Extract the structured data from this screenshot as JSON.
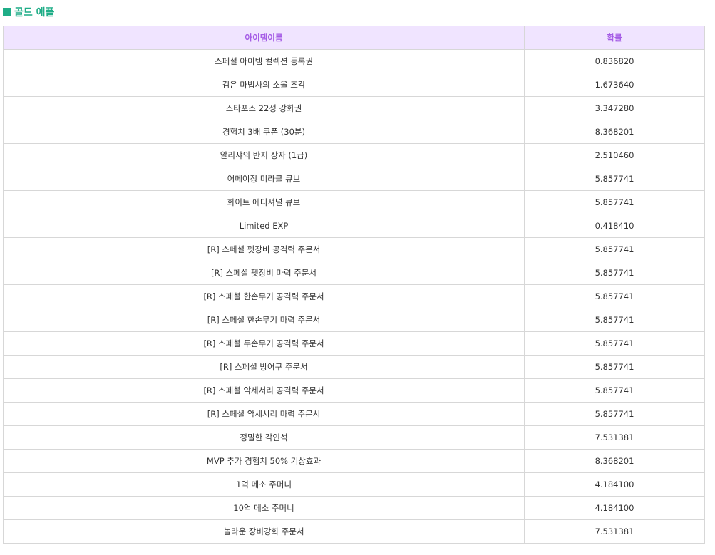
{
  "section": {
    "title": "골드 애플",
    "accent_color": "#1fad87",
    "icon": "square-bullet-icon"
  },
  "table": {
    "header_bg": "#f0e4ff",
    "header_color": "#a55ce6",
    "columns": [
      "아이템이름",
      "확률"
    ],
    "rows": [
      {
        "name": "스페셜 아이템 컬렉션 등록권",
        "prob": "0.836820"
      },
      {
        "name": "검은 마법사의 소울 조각",
        "prob": "1.673640"
      },
      {
        "name": "스타포스 22성 강화권",
        "prob": "3.347280"
      },
      {
        "name": "경험치 3배 쿠폰 (30분)",
        "prob": "8.368201"
      },
      {
        "name": "알리샤의 반지 상자 (1급)",
        "prob": "2.510460"
      },
      {
        "name": "어메이징 미라클 큐브",
        "prob": "5.857741"
      },
      {
        "name": "화이트 에디셔널 큐브",
        "prob": "5.857741"
      },
      {
        "name": "Limited EXP",
        "prob": "0.418410"
      },
      {
        "name": "[R] 스페셜 펫장비 공격력 주문서",
        "prob": "5.857741"
      },
      {
        "name": "[R] 스페셜 펫장비 마력 주문서",
        "prob": "5.857741"
      },
      {
        "name": "[R] 스페셜 한손무기 공격력 주문서",
        "prob": "5.857741"
      },
      {
        "name": "[R] 스페셜 한손무기 마력 주문서",
        "prob": "5.857741"
      },
      {
        "name": "[R] 스페셜 두손무기 공격력 주문서",
        "prob": "5.857741"
      },
      {
        "name": "[R] 스페셜 방어구 주문서",
        "prob": "5.857741"
      },
      {
        "name": "[R] 스페셜 악세서리 공격력 주문서",
        "prob": "5.857741"
      },
      {
        "name": "[R] 스페셜 악세서리 마력 주문서",
        "prob": "5.857741"
      },
      {
        "name": "정밀한 각인석",
        "prob": "7.531381"
      },
      {
        "name": "MVP 추가 경험치 50% 기상효과",
        "prob": "8.368201"
      },
      {
        "name": "1억 메소 주머니",
        "prob": "4.184100"
      },
      {
        "name": "10억 메소 주머니",
        "prob": "4.184100"
      },
      {
        "name": "놀라운 장비강화 주문서",
        "prob": "7.531381"
      }
    ]
  }
}
